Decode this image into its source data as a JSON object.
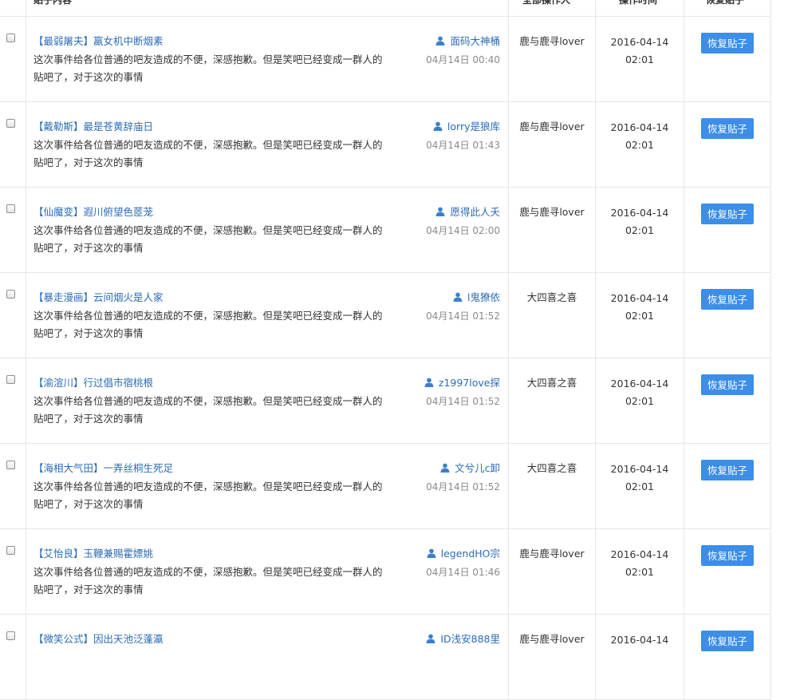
{
  "header": {
    "col_post": "贴子内容",
    "col_operator": "全部操作人",
    "col_time": "操作时间",
    "col_restore": "恢复贴子"
  },
  "restore_label": "恢复贴子",
  "rows": [
    {
      "title": "【最弱屠夫】羸女机中断烟素",
      "content": "这次事件给各位普通的吧友造成的不便，深感抱歉。但是笑吧已经变成一群人的贴吧了，对于这次的事情",
      "author": "面码大神桶",
      "post_time": "04月14日 00:40",
      "operator": "鹿与鹿寻lover",
      "op_date": "2016-04-14",
      "op_clock": "02:01"
    },
    {
      "title": "【戴勒斯】最是苍黄辞庙日",
      "content": "这次事件给各位普通的吧友造成的不便，深感抱歉。但是笑吧已经变成一群人的贴吧了，对于这次的事情",
      "author": "lorry是狼库",
      "post_time": "04月14日 01:43",
      "operator": "鹿与鹿寻lover",
      "op_date": "2016-04-14",
      "op_clock": "02:01"
    },
    {
      "title": "【仙魔变】遐川俯望色茝茏",
      "content": "这次事件给各位普通的吧友造成的不便，深感抱歉。但是笑吧已经变成一群人的贴吧了，对于这次的事情",
      "author": "愿得此人夭",
      "post_time": "04月14日 02:00",
      "operator": "鹿与鹿寻lover",
      "op_date": "2016-04-14",
      "op_clock": "02:01"
    },
    {
      "title": "【暴走漫画】云间烟火是人家",
      "content": "这次事件给各位普通的吧友造成的不便，深感抱歉。但是笑吧已经变成一群人的贴吧了，对于这次的事情",
      "author": "l鬼獠依",
      "post_time": "04月14日 01:52",
      "operator": "大四喜之喜",
      "op_date": "2016-04-14",
      "op_clock": "02:01"
    },
    {
      "title": "【渝渲川】行过倡市宿桃根",
      "content": "这次事件给各位普通的吧友造成的不便，深感抱歉。但是笑吧已经变成一群人的贴吧了，对于这次的事情",
      "author": "z1997love探",
      "post_time": "04月14日 01:52",
      "operator": "大四喜之喜",
      "op_date": "2016-04-14",
      "op_clock": "02:01"
    },
    {
      "title": "【海相大气田】一弄丝桐生死足",
      "content": "这次事件给各位普通的吧友造成的不便，深感抱歉。但是笑吧已经变成一群人的贴吧了，对于这次的事情",
      "author": "文兮儿c卸",
      "post_time": "04月14日 01:52",
      "operator": "大四喜之喜",
      "op_date": "2016-04-14",
      "op_clock": "02:01"
    },
    {
      "title": "【艾怡良】玉鞭兼赐霍嫖姚",
      "content": "这次事件给各位普通的吧友造成的不便，深感抱歉。但是笑吧已经变成一群人的贴吧了，对于这次的事情",
      "author": "legendHO宗",
      "post_time": "04月14日 01:46",
      "operator": "鹿与鹿寻lover",
      "op_date": "2016-04-14",
      "op_clock": "02:01"
    },
    {
      "title": "【微笑公式】因出天池泛蓬瀛",
      "content": "",
      "author": "ID浅安888里",
      "post_time": "",
      "operator": "鹿与鹿寻lover",
      "op_date": "2016-04-14",
      "op_clock": ""
    }
  ]
}
